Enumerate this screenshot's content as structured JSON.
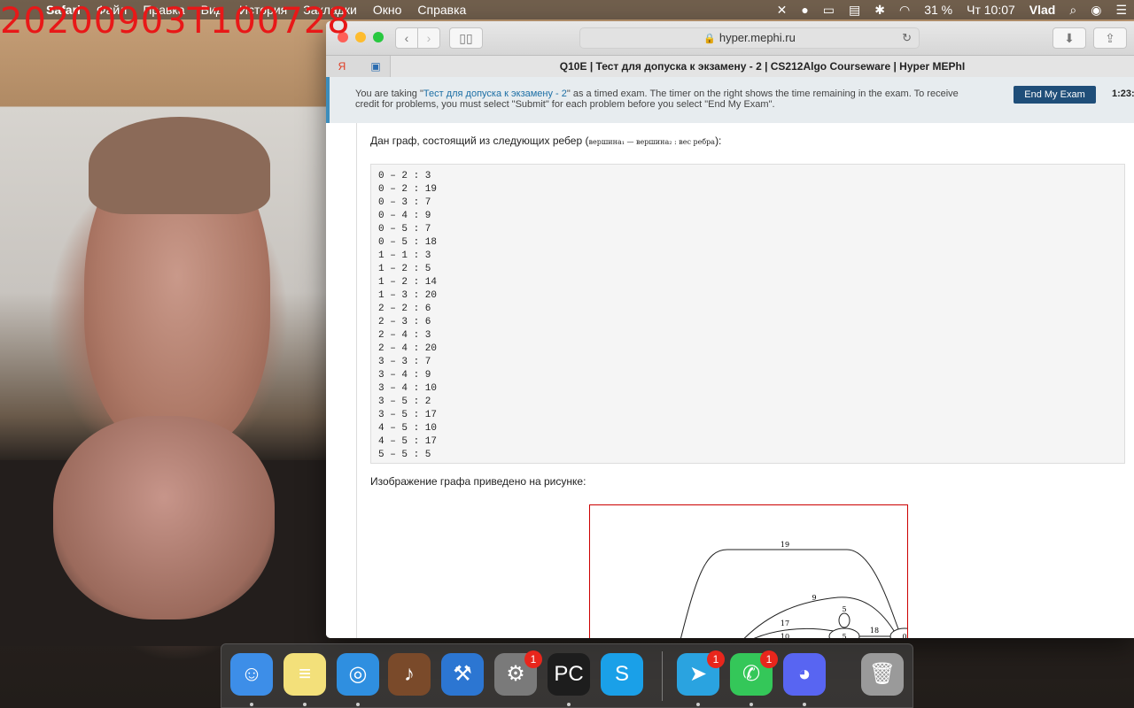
{
  "webcam": {
    "timestamp": "20200903T100728"
  },
  "menubar": {
    "app": "Safari",
    "items": [
      "Файл",
      "Правка",
      "Вид",
      "История",
      "Закладки",
      "Окно",
      "Справка"
    ],
    "status": {
      "battery": "31 %",
      "clock": "Чт 10:07",
      "user": "Vlad"
    }
  },
  "browser": {
    "url": "hyper.mephi.ru",
    "tab_title": "Q10E | Тест для допуска к экзамену - 2 | CS212Algo Courseware | Hyper MEPhI"
  },
  "banner": {
    "text_before": "You are taking \"",
    "exam_link": "Тест для допуска к экзамену - 2",
    "text_after": "\" as a timed exam. The timer on the right shows the time remaining in the exam. To receive credit for problems, you must select \"Submit\" for each problem before you select \"End My Exam\".",
    "end_button": "End My Exam",
    "timer": "1:23:"
  },
  "problem": {
    "intro": "Дан граф, состоящий из следующих ребер (",
    "intro_formula": "вершина₁ — вершина₂ : вес ребра",
    "intro_end": "):",
    "edges": [
      "0 – 2 : 3",
      "0 – 2 : 19",
      "0 – 3 : 7",
      "0 – 4 : 9",
      "0 – 5 : 7",
      "0 – 5 : 18",
      "1 – 1 : 3",
      "1 – 2 : 5",
      "1 – 2 : 14",
      "1 – 3 : 20",
      "2 – 2 : 6",
      "2 – 3 : 6",
      "2 – 4 : 3",
      "2 – 4 : 20",
      "3 – 3 : 7",
      "3 – 4 : 9",
      "3 – 4 : 10",
      "3 – 5 : 2",
      "3 – 5 : 17",
      "4 – 5 : 10",
      "4 – 5 : 17",
      "5 – 5 : 5"
    ],
    "caption": "Изображение графа приведено на рисунке:",
    "graph_labels": {
      "e19": "19",
      "e9": "9",
      "e17": "17",
      "e10": "10",
      "loop5": "5",
      "node5": "5",
      "e18": "18",
      "node0": "0"
    }
  },
  "dock": {
    "apps": [
      {
        "name": "Finder",
        "icon": "finder-icon",
        "color": "#3d8ee8",
        "glyph": "☺",
        "running": true,
        "badge": ""
      },
      {
        "name": "Notes",
        "icon": "notes-icon",
        "color": "#f3e07a",
        "glyph": "≡",
        "running": true,
        "badge": ""
      },
      {
        "name": "Safari",
        "icon": "safari-icon",
        "color": "#2f8fe0",
        "glyph": "◎",
        "running": true,
        "badge": ""
      },
      {
        "name": "GarageBand",
        "icon": "garageband-icon",
        "color": "#7a4a2a",
        "glyph": "♪",
        "running": false,
        "badge": ""
      },
      {
        "name": "Xcode",
        "icon": "xcode-icon",
        "color": "#2c76d2",
        "glyph": "⚒",
        "running": false,
        "badge": ""
      },
      {
        "name": "System Preferences",
        "icon": "gear-icon",
        "color": "#7a7a7a",
        "glyph": "⚙",
        "running": false,
        "badge": "1"
      },
      {
        "name": "PyCharm",
        "icon": "pycharm-icon",
        "color": "#1d1d1d",
        "glyph": "PC",
        "running": true,
        "badge": ""
      },
      {
        "name": "Skype",
        "icon": "skype-icon",
        "color": "#1aa0e8",
        "glyph": "S",
        "running": false,
        "badge": ""
      },
      {
        "name": "Telegram",
        "icon": "telegram-icon",
        "color": "#2aa3e0",
        "glyph": "➤",
        "running": true,
        "badge": "1"
      },
      {
        "name": "FaceTime",
        "icon": "facetime-icon",
        "color": "#34c759",
        "glyph": "✆",
        "running": true,
        "badge": "1"
      },
      {
        "name": "Discord",
        "icon": "discord-icon",
        "color": "#5865f2",
        "glyph": "◕",
        "running": true,
        "badge": ""
      },
      {
        "name": "Trash",
        "icon": "trash-icon",
        "color": "#9a9a9a",
        "glyph": "🗑",
        "running": false,
        "badge": ""
      }
    ]
  }
}
